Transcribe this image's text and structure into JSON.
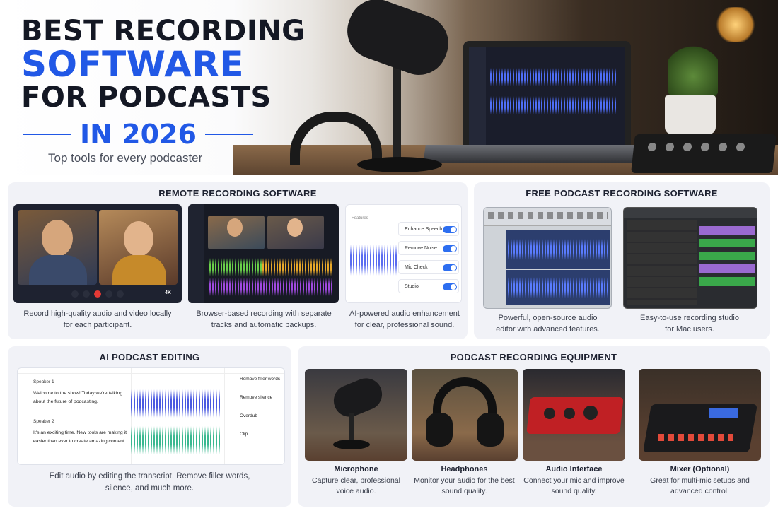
{
  "hero": {
    "line1": "BEST RECORDING",
    "line2": "SOFTWARE",
    "line3": "FOR PODCASTS",
    "year": "IN 2026",
    "subtitle": "Top tools for every podcaster"
  },
  "remote": {
    "title": "REMOTE RECORDING SOFTWARE",
    "cards": [
      {
        "caption": "Record high-quality audio and video locally for each participant.",
        "badge": "4K"
      },
      {
        "caption": "Browser-based recording with separate tracks and automatic backups."
      },
      {
        "caption": "AI-powered audio enhancement for clear, professional sound.",
        "header": "Features",
        "features": [
          "Enhance Speech",
          "Remove Noise",
          "Mic Check",
          "Studio"
        ]
      }
    ]
  },
  "free": {
    "title": "FREE PODCAST RECORDING SOFTWARE",
    "cards": [
      {
        "caption": "Powerful, open-source audio editor with advanced features."
      },
      {
        "caption": "Easy-to-use recording studio for Mac users."
      }
    ]
  },
  "ai": {
    "title": "AI PODCAST EDITING",
    "speaker1": "Speaker 1",
    "text1": "Welcome to the show! Today we're talking about the future of podcasting.",
    "speaker2": "Speaker 2",
    "text2": "It's an exciting time. New tools are making it easier than ever to create amazing content.",
    "actions": [
      "Remove filler words",
      "Remove silence",
      "Overdub",
      "Clip"
    ],
    "caption": "Edit audio by editing the transcript. Remove filler words, silence, and much more."
  },
  "equipment": {
    "title": "PODCAST RECORDING EQUIPMENT",
    "items": [
      {
        "name": "Microphone",
        "caption": "Capture clear, professional voice audio."
      },
      {
        "name": "Headphones",
        "caption": "Monitor your audio for the best sound quality."
      },
      {
        "name": "Audio Interface",
        "caption": "Connect your mic and improve sound quality."
      },
      {
        "name": "Mixer (Optional)",
        "caption": "Great for multi-mic setups and advanced control."
      }
    ]
  },
  "colors": {
    "accent": "#2158e6",
    "panel": "#f1f2f7",
    "toggle": "#2d6ef0"
  }
}
